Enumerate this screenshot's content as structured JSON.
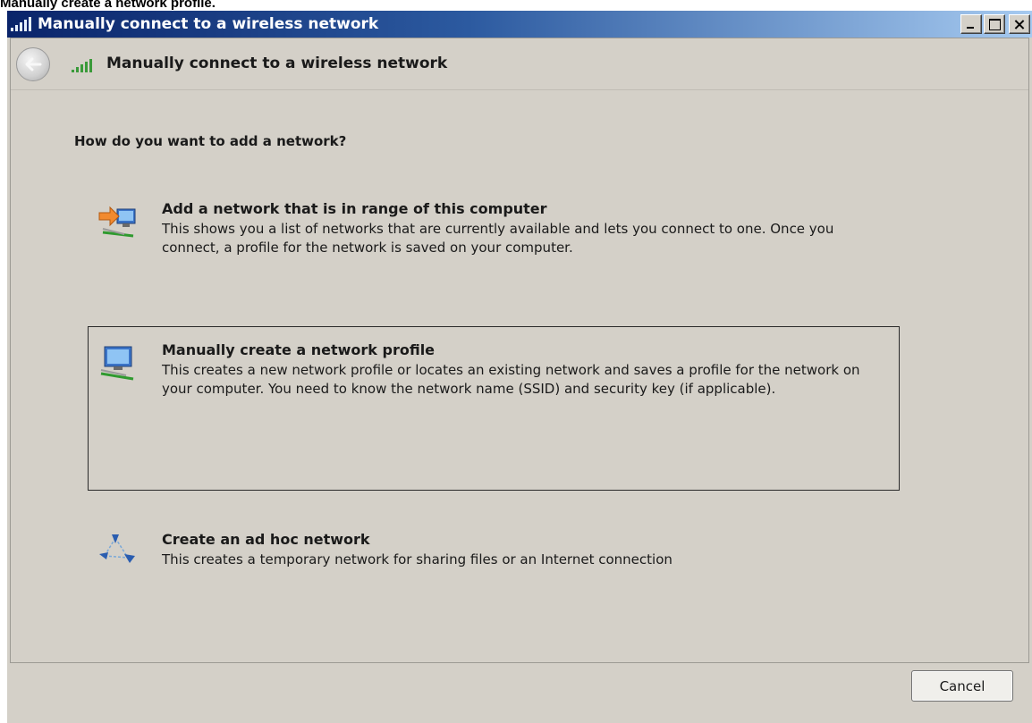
{
  "caption": "Manually create a network profile.",
  "window": {
    "title": "Manually connect to a wireless network",
    "controls": {
      "minimize": "minimize",
      "maximize": "maximize",
      "close": "close"
    }
  },
  "header": {
    "title": "Manually connect to a wireless network",
    "back_icon": "back-arrow-icon",
    "signal_icon": "wireless-signal-icon"
  },
  "question": "How do you want to add a network?",
  "options": [
    {
      "title": "Add a network that is in range of this computer",
      "description": "This shows you a list of networks that are currently available and lets you connect to one. Once you connect, a profile for the network is saved on your computer.",
      "icon": "network-arrow-icon",
      "selected": false
    },
    {
      "title": "Manually create a network profile",
      "description": "This creates a new network profile or locates an existing network and saves a profile for the network on your computer. You need to know the network name (SSID) and security key (if applicable).",
      "icon": "network-computer-icon",
      "selected": true
    },
    {
      "title": "Create an ad hoc network",
      "description": "This creates a temporary network for sharing files or an Internet connection",
      "icon": "ad-hoc-network-icon",
      "selected": false
    }
  ],
  "footer": {
    "cancel_label": "Cancel"
  },
  "colors": {
    "titlebar_start": "#0a246a",
    "titlebar_end": "#a6caf0",
    "dialog_bg": "#d4d0c8"
  }
}
